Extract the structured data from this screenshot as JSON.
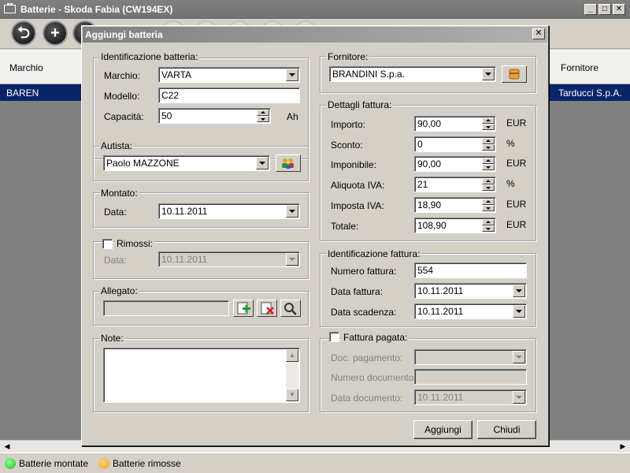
{
  "window": {
    "title": "Batterie - Skoda Fabia (CW194EX)",
    "minimize": "_",
    "maximize": "□",
    "close": "✕"
  },
  "toolbar": {
    "exit_glyph": "⮌",
    "add_glyph": "+"
  },
  "grid": {
    "columns": {
      "marchio": "Marchio",
      "fornitore": "Fornitore"
    },
    "selected_row": {
      "marchio": "BAREN",
      "fornitore": "Tarducci S.p.A."
    }
  },
  "status": {
    "montate": {
      "label": "Batterie montate",
      "color": "#2db82d"
    },
    "rimosse": {
      "label": "Batterie rimosse",
      "color": "#f0a020"
    }
  },
  "dialog": {
    "title": "Aggiungi batteria",
    "close": "✕",
    "identificazione": {
      "label": "Identificazione batteria:",
      "marchio_label": "Marchio:",
      "marchio": "VARTA",
      "modello_label": "Modello:",
      "modello": "C22",
      "capacita_label": "Capacità:",
      "capacita": "50",
      "capacita_unit": "Ah"
    },
    "autista": {
      "label": "Autista:",
      "value": "Paolo MAZZONE"
    },
    "montato": {
      "label": "Montato:",
      "data_label": "Data:",
      "data": "10.11.2011"
    },
    "rimossi": {
      "label": "Rimossi:",
      "data_label": "Data:",
      "data": "10.11.2011"
    },
    "allegato": {
      "label": "Allegato:",
      "value": ""
    },
    "note": {
      "label": "Note:",
      "value": ""
    },
    "fornitore": {
      "label": "Fornitore:",
      "value": "BRANDINI S.p.a."
    },
    "dettagli": {
      "label": "Dettagli fattura:",
      "rows": [
        {
          "label": "Importo:",
          "value": "90,00",
          "unit": "EUR"
        },
        {
          "label": "Sconto:",
          "value": "0",
          "unit": "%"
        },
        {
          "label": "Imponibile:",
          "value": "90,00",
          "unit": "EUR"
        },
        {
          "label": "Aliquota IVA:",
          "value": "21",
          "unit": "%"
        },
        {
          "label": "Imposta IVA:",
          "value": "18,90",
          "unit": "EUR"
        },
        {
          "label": "Totale:",
          "value": "108,90",
          "unit": "EUR"
        }
      ]
    },
    "id_fattura": {
      "label": "Identificazione fattura:",
      "numero_label": "Numero fattura:",
      "numero": "554",
      "data_label": "Data fattura:",
      "data": "10.11.2011",
      "scadenza_label": "Data scadenza:",
      "scadenza": "10.11.2011"
    },
    "pagata": {
      "label": "Fattura pagata:",
      "doc_pag_label": "Doc. pagamento:",
      "doc_pag": "",
      "num_doc_label": "Numero documento:",
      "num_doc": "",
      "data_doc_label": "Data documento:",
      "data_doc": "10.11.2011"
    },
    "buttons": {
      "add": "Aggiungi",
      "close": "Chiudi"
    }
  }
}
